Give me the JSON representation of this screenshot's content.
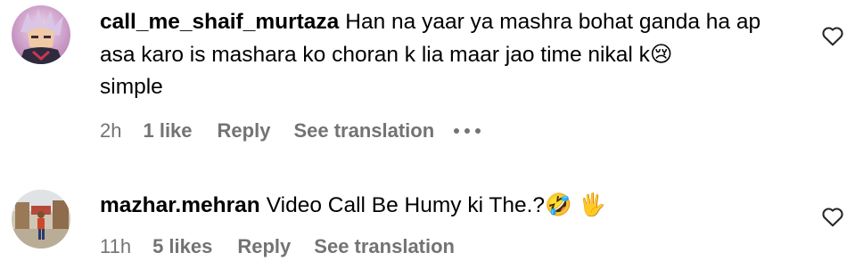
{
  "comments": [
    {
      "username": "call_me_shaif_murtaza",
      "text": "Han na yaar ya mashra bohat ganda ha ap asa karo is mashara ko choran k lia maar jao time nikal k",
      "emoji_after": "😢",
      "text_tail": " simple",
      "time": "2h",
      "likes": "1 like",
      "reply": "Reply",
      "translate": "See translation",
      "has_more": true,
      "avatar_icon": "anime-character-avatar",
      "like_icon": "heart-outline-icon"
    },
    {
      "username": "mazhar.mehran",
      "text": "Video Call Be Humy ki The.?",
      "emoji_after": "🤣 🖐",
      "text_tail": "",
      "time": "11h",
      "likes": "5 likes",
      "reply": "Reply",
      "translate": "See translation",
      "has_more": false,
      "avatar_icon": "person-photo-avatar",
      "like_icon": "heart-outline-icon"
    }
  ],
  "colors": {
    "text": "#000000",
    "meta": "#737373",
    "background": "#ffffff"
  }
}
